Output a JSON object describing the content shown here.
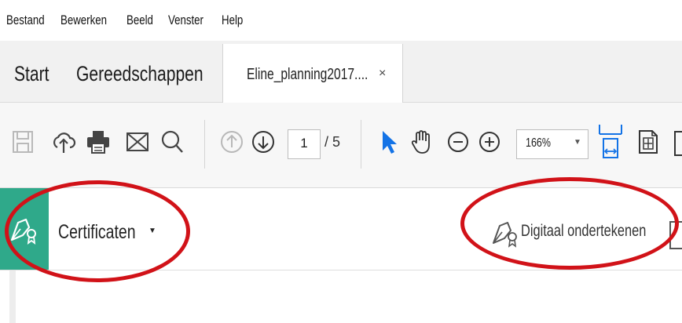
{
  "menu": {
    "items": [
      "Bestand",
      "Bewerken",
      "Beeld",
      "Venster",
      "Help"
    ]
  },
  "tabs": {
    "home": "Start",
    "tools": "Gereedschappen",
    "document": "Eline_planning2017....",
    "close": "×"
  },
  "toolbar": {
    "icons": [
      "save-icon",
      "cloud-upload-icon",
      "print-icon",
      "mail-icon",
      "search-icon",
      "page-up-icon",
      "page-down-icon",
      "select-cursor-icon",
      "hand-icon",
      "zoom-out-icon",
      "zoom-in-icon",
      "fit-width-icon",
      "scroll-mode-icon"
    ],
    "page_current": "1",
    "page_total": "/ 5",
    "zoom": "166%"
  },
  "certificates": {
    "title": "Certificaten",
    "sign_label": "Digitaal ondertekenen"
  },
  "colors": {
    "accent_green": "#2fa98a",
    "annotation_red": "#d11218",
    "select_blue": "#1473e6"
  }
}
